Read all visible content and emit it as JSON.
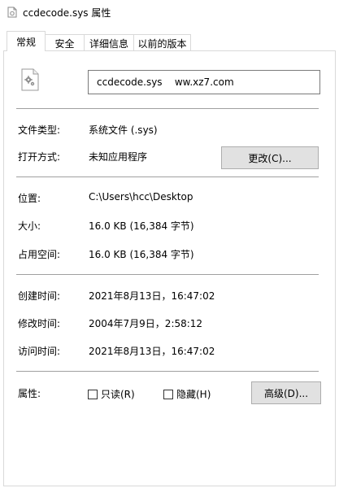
{
  "window": {
    "title": "ccdecode.sys 属性"
  },
  "tabs": [
    {
      "label": "常规",
      "active": true
    },
    {
      "label": "安全",
      "active": false
    },
    {
      "label": "详细信息",
      "active": false
    },
    {
      "label": "以前的版本",
      "active": false
    }
  ],
  "general": {
    "file_name": "ccdecode.sys    ww.xz7.com",
    "file_icon": "system-file-gear-icon",
    "type_label": "文件类型:",
    "type_value": "系统文件 (.sys)",
    "open_with_label": "打开方式:",
    "open_with_value": "未知应用程序",
    "change_button": "更改(C)...",
    "location_label": "位置:",
    "location_value": "C:\\Users\\hcc\\Desktop",
    "size_label": "大小:",
    "size_value": "16.0 KB (16,384 字节)",
    "size_on_disk_label": "占用空间:",
    "size_on_disk_value": "16.0 KB (16,384 字节)",
    "created_label": "创建时间:",
    "created_value": "2021年8月13日，16:47:02",
    "modified_label": "修改时间:",
    "modified_value": "2004年7月9日，2:58:12",
    "accessed_label": "访问时间:",
    "accessed_value": "2021年8月13日，16:47:02",
    "attributes_label": "属性:",
    "readonly_label": "只读(R)",
    "readonly_checked": false,
    "hidden_label": "隐藏(H)",
    "hidden_checked": false,
    "advanced_button": "高级(D)..."
  }
}
